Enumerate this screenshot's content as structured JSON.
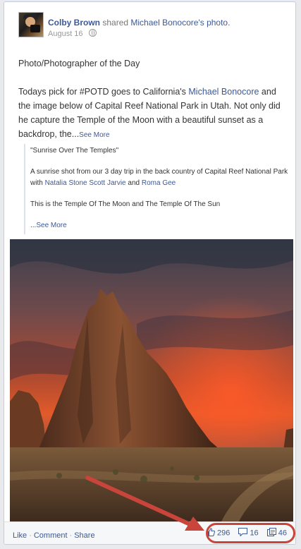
{
  "post": {
    "author": "Colby Brown",
    "shared_verb": "shared",
    "shared_link": "Michael Bonocore's photo.",
    "date": "August 16",
    "intro": "Photo/Photographer of the Day",
    "text_part1": "Todays pick for #POTD goes to California's ",
    "text_link": "Michael Bonocore",
    "text_part2": " and the image below of Capital Reef National Park in Utah. Not only did he capture the Temple of the Moon with a beautiful sunset as a backdrop, the...",
    "see_more": "See More"
  },
  "quote": {
    "title": "\"Sunrise Over The Temples\"",
    "body_part1": "A sunrise shot from our 3 day trip in the back country of Capital Reef National Park with ",
    "link1": "Natalia Stone Scott Jarvie",
    "and_text": " and ",
    "link2": "Roma Gee",
    "line2": "This is the Temple Of The Moon and The Temple Of The Sun",
    "ellipsis": "...",
    "see_more": "See More"
  },
  "actions": {
    "like": "Like",
    "comment": "Comment",
    "share": "Share",
    "sep": "·"
  },
  "counts": {
    "likes": "296",
    "comments": "16",
    "shares": "46"
  },
  "icons": {
    "privacy": "globe-icon",
    "likes": "thumbs-up-icon",
    "comments": "comment-bubble-icon",
    "shares": "share-icon"
  },
  "colors": {
    "link": "#3b5998",
    "annotation": "#c9443a"
  }
}
